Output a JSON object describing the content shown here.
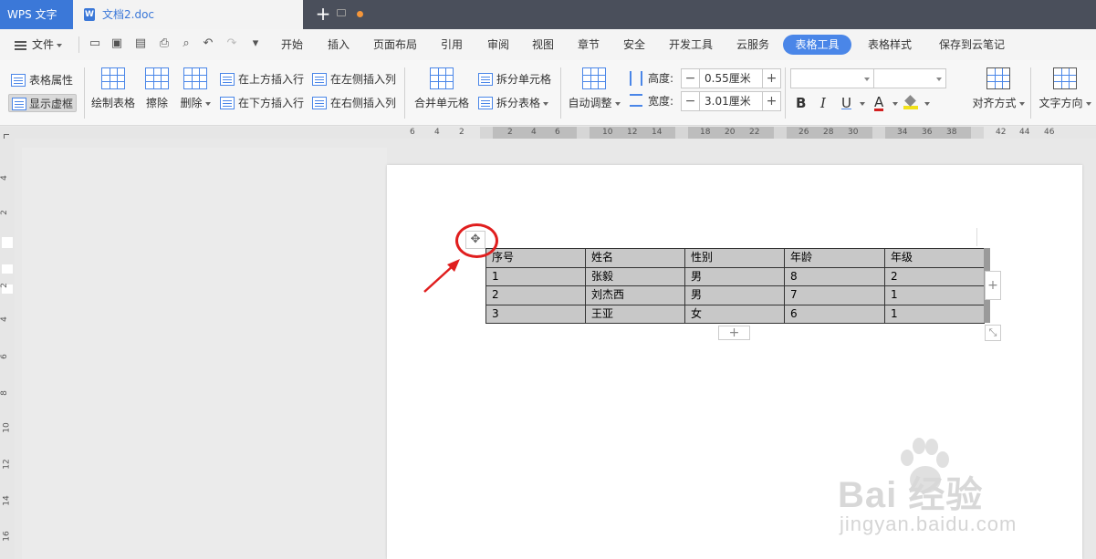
{
  "titlebar": {
    "app_name": "WPS 文字",
    "doc_name": "文档2.doc",
    "doc_icon": "W",
    "new_tab": "+"
  },
  "menubar": {
    "file_label": "文件",
    "items": [
      "开始",
      "插入",
      "页面布局",
      "引用",
      "审阅",
      "视图",
      "章节",
      "安全",
      "开发工具",
      "云服务"
    ],
    "active_tab": "表格工具",
    "after_items": [
      "表格样式",
      "保存到云笔记"
    ]
  },
  "ribbon": {
    "table_props": "表格属性",
    "show_grid": "显示虚框",
    "draw_table": "绘制表格",
    "erase": "擦除",
    "delete": "删除",
    "insert_above": "在上方插入行",
    "insert_below": "在下方插入行",
    "insert_left": "在左侧插入列",
    "insert_right": "在右侧插入列",
    "merge_cells": "合并单元格",
    "split_cells": "拆分单元格",
    "split_table": "拆分表格",
    "auto_fit": "自动调整",
    "height_label": "高度:",
    "height_value": "0.55厘米",
    "width_label": "宽度:",
    "width_value": "3.01厘米",
    "bold": "B",
    "italic": "I",
    "underline": "U",
    "font_color": "A",
    "align": "对齐方式",
    "text_direction": "文字方向"
  },
  "ruler": {
    "h_left": [
      "6",
      "4",
      "2"
    ],
    "h_right": [
      "2",
      "4",
      "6",
      "10",
      "12",
      "14",
      "18",
      "20",
      "22",
      "26",
      "28",
      "30",
      "34",
      "36",
      "38",
      "42",
      "44",
      "46"
    ],
    "v_numbers": [
      "4",
      "2",
      "2",
      "4",
      "6",
      "8",
      "10",
      "12",
      "14",
      "16"
    ]
  },
  "table": {
    "rows": [
      [
        "序号",
        "姓名",
        "性别",
        "年龄",
        "年级"
      ],
      [
        "1",
        "张毅",
        "男",
        "8",
        "2"
      ],
      [
        "2",
        "刘杰西",
        "男",
        "7",
        "1"
      ],
      [
        "3",
        "王亚",
        "女",
        "6",
        "1"
      ]
    ]
  },
  "controls": {
    "move_handle": "✥",
    "add_col": "+",
    "add_row": "+",
    "resize": "⤡"
  },
  "watermark": {
    "main": "Bai 经验",
    "sub": "jingyan.baidu.com"
  },
  "colors": {
    "titlebar": "#4a4f5b",
    "accent": "#3b78d8",
    "active_tab": "#4a86e8",
    "annotation": "#e01e1e"
  }
}
